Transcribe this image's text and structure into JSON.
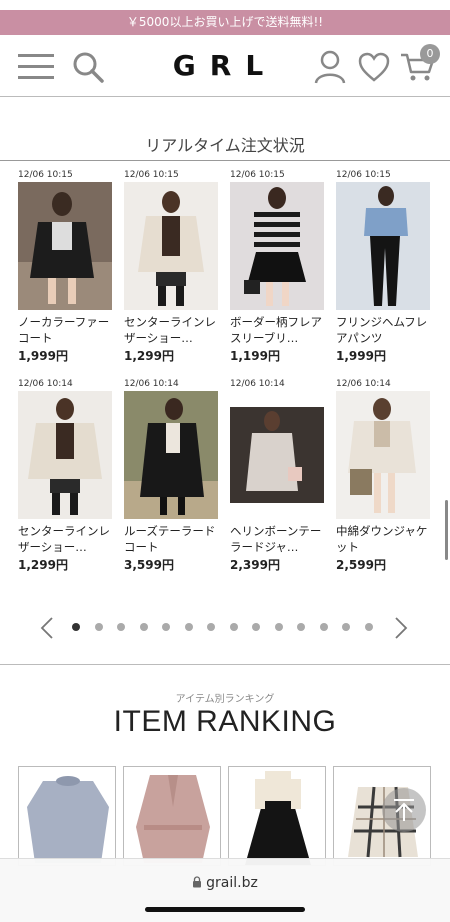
{
  "promo": {
    "text": "￥5000以上お買い上げで送料無料!!"
  },
  "header": {
    "logo": "GRL",
    "cart_count": "0"
  },
  "realtime": {
    "title": "リアルタイム注文状況",
    "items": [
      {
        "time": "12/06 10:15",
        "name": "ノーカラーファーコート",
        "price": "1,999円"
      },
      {
        "time": "12/06 10:15",
        "name": "センターラインレザーショー…",
        "price": "1,299円"
      },
      {
        "time": "12/06 10:15",
        "name": "ボーダー柄フレアスリーブリ…",
        "price": "1,199円"
      },
      {
        "time": "12/06 10:15",
        "name": "フリンジヘムフレアパンツ",
        "price": "1,999円"
      },
      {
        "time": "12/06 10:14",
        "name": "センターラインレザーショー…",
        "price": "1,299円"
      },
      {
        "time": "12/06 10:14",
        "name": "ルーズテーラードコート",
        "price": "3,599円"
      },
      {
        "time": "12/06 10:14",
        "name": "ヘリンボーンテーラードジャ…",
        "price": "2,399円"
      },
      {
        "time": "12/06 10:14",
        "name": "中綿ダウンジャケット",
        "price": "2,599円"
      }
    ],
    "page_count": 14,
    "active_page": 1
  },
  "ranking": {
    "subtitle": "アイテム別ランキング",
    "title": "ITEM RANKING"
  },
  "browser": {
    "url": "grail.bz"
  }
}
